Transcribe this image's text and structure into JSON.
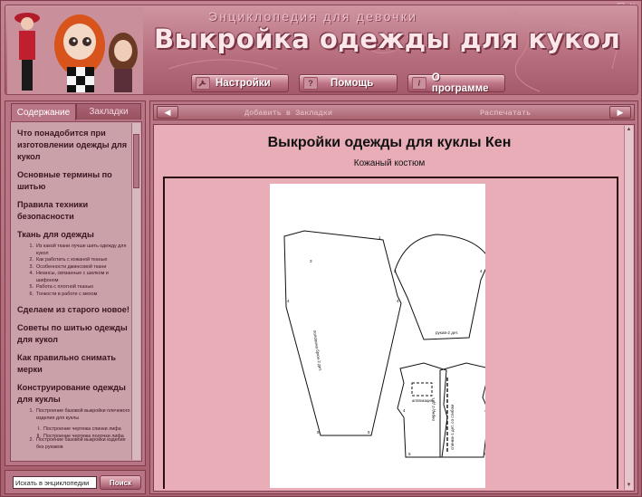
{
  "window": {
    "controls": [
      "_",
      "□",
      "×"
    ]
  },
  "header": {
    "subtitle": "Энциклопедия для девочки",
    "title": "Выкройка одежды для кукол",
    "nav": [
      {
        "label": "Настройки",
        "icon": "wrench-icon"
      },
      {
        "label": "Помощь",
        "icon": "question-icon",
        "glyph": "?"
      },
      {
        "label": "О программе",
        "icon": "info-icon",
        "glyph": "/"
      }
    ]
  },
  "sidebar": {
    "tabs": [
      "Содержание",
      "Закладки"
    ],
    "active_tab": "Содержание",
    "items": [
      {
        "label": "Что понадобится при изготовлении одежды для кукол"
      },
      {
        "label": "Основные термины по шитью"
      },
      {
        "label": "Правила техники безопасности"
      },
      {
        "label": "Ткань для одежды",
        "children": [
          {
            "n": "1.",
            "label": "Из какой ткани лучше шить одежду для кукол"
          },
          {
            "n": "2.",
            "label": "Как работать с кожаной тканью"
          },
          {
            "n": "3.",
            "label": "Особенности джинсовой ткани"
          },
          {
            "n": "4.",
            "label": "Нюансы, связанные с шелком и шифоном"
          },
          {
            "n": "5.",
            "label": "Работа с плотной тканью"
          },
          {
            "n": "6.",
            "label": "Тонкости в работе с мехом"
          }
        ]
      },
      {
        "label": "Сделаем из старого новое!"
      },
      {
        "label": "Советы по шитью одежды для кукол"
      },
      {
        "label": "Как правильно снимать мерки"
      },
      {
        "label": "Конструирование одежды для куклы",
        "children": [
          {
            "n": "1.",
            "label": "Построение базовой выкройки плечевого изделия для куклы"
          },
          {
            "n": "I.",
            "label": "Построение чертежа спинки лифа",
            "deep": true
          },
          {
            "n": "II.",
            "label": "Построение чертежа полочки лифа",
            "deep": true
          },
          {
            "n": "2.",
            "label": "Построение базовой выкройки изделия без рукавов"
          }
        ]
      }
    ]
  },
  "search": {
    "placeholder": "Искать в энциклопедии",
    "button_label": "Поиск"
  },
  "toolbar": {
    "bookmark_label": "Добавить в Закладки",
    "print_label": "Распечатать"
  },
  "document": {
    "title": "Выкройки одежды для куклы Кен",
    "subtitle": "Кожаный костюм",
    "pattern_labels": {
      "trousers": "половина брюк-2 дет.",
      "sleeve": "рукав-2 дет.",
      "applique": "аппликация",
      "front": "перед-2 дет.",
      "back": "спинка-1 дет. со сгибом",
      "numbers": [
        "1",
        "2",
        "3",
        "4",
        "5"
      ]
    }
  },
  "colors": {
    "frame_bg": "#b87585",
    "content_bg": "#e8adb7",
    "accent": "#7e3b4a"
  }
}
